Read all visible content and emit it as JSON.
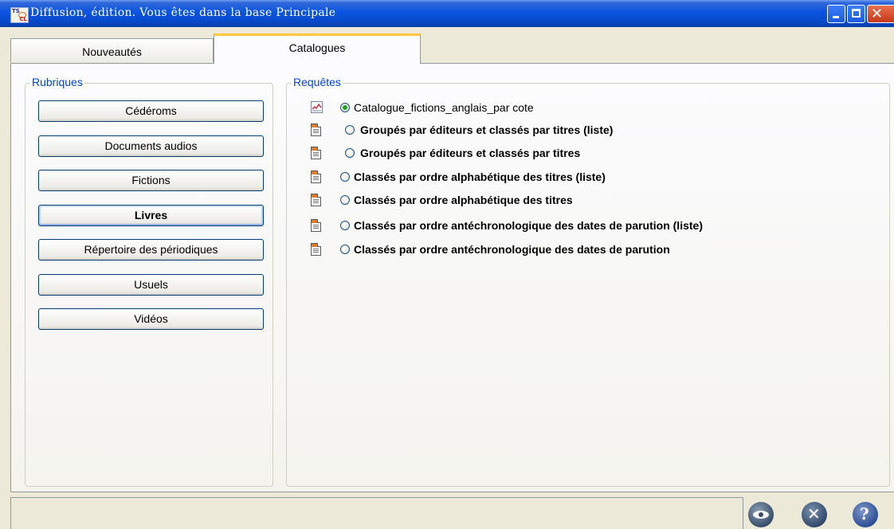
{
  "window": {
    "title": "Diffusion, édition.  Vous êtes dans la base Principale",
    "app_icon_text_top": "TS",
    "app_icon_text_bottom": "CL"
  },
  "tabs": [
    {
      "label": "Nouveautés",
      "active": false
    },
    {
      "label": "Catalogues",
      "active": true
    }
  ],
  "rubriques": {
    "legend": "Rubriques",
    "items": [
      {
        "label": "Cédéroms",
        "selected": false
      },
      {
        "label": "Documents audios",
        "selected": false
      },
      {
        "label": "Fictions",
        "selected": false
      },
      {
        "label": "Livres",
        "selected": true
      },
      {
        "label": "Répertoire des périodiques",
        "selected": false
      },
      {
        "label": "Usuels",
        "selected": false
      },
      {
        "label": "Vidéos",
        "selected": false
      }
    ]
  },
  "requetes": {
    "legend": "Requêtes",
    "items": [
      {
        "label": "Catalogue_fictions_anglais_par cote",
        "icon": "chart-report-icon",
        "checked": true
      },
      {
        "label": "Groupés par éditeurs et classés par titres (liste)",
        "icon": "document-icon",
        "checked": false
      },
      {
        "label": "Groupés par éditeurs et classés par titres",
        "icon": "document-icon",
        "checked": false
      },
      {
        "label": "Classés par ordre alphabétique des titres (liste)",
        "icon": "document-icon",
        "checked": false
      },
      {
        "label": "Classés par ordre alphabétique des titres",
        "icon": "document-icon",
        "checked": false
      },
      {
        "label": "Classés par ordre antéchronologique des dates de parution (liste)",
        "icon": "document-icon",
        "checked": false
      },
      {
        "label": "Classés par ordre antéchronologique des dates de parution",
        "icon": "document-icon",
        "checked": false
      }
    ]
  },
  "footer": {
    "status_text": "",
    "buttons": [
      "eye-icon",
      "cancel-icon",
      "help-icon"
    ]
  },
  "colors": {
    "titlebar": "#0a54e0",
    "legend_text": "#0046d5",
    "active_tab_accent": "#ffc83c",
    "document_icon_accent": "#e37b24",
    "radio_checked": "#21a121"
  }
}
